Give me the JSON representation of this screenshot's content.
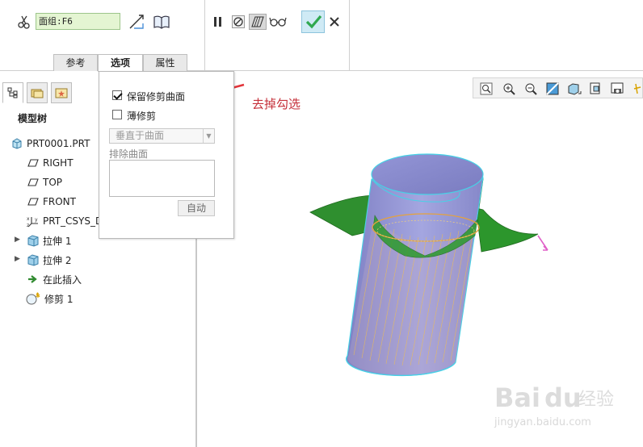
{
  "dashboard": {
    "reference_value": "面组:F6",
    "tabs": [
      {
        "label": "参考",
        "active": false
      },
      {
        "label": "选项",
        "active": true
      },
      {
        "label": "属性",
        "active": false
      }
    ]
  },
  "left_panel": {
    "title": "模型树",
    "items": [
      {
        "label": "PRT0001.PRT",
        "icon": "part-icon"
      },
      {
        "label": "RIGHT",
        "icon": "datum-plane-icon"
      },
      {
        "label": "TOP",
        "icon": "datum-plane-icon"
      },
      {
        "label": "FRONT",
        "icon": "datum-plane-icon"
      },
      {
        "label": "PRT_CSYS_D",
        "icon": "csys-icon"
      },
      {
        "label": "拉伸 1",
        "icon": "extrude-icon",
        "expandable": true
      },
      {
        "label": "拉伸 2",
        "icon": "extrude-icon",
        "expandable": true
      },
      {
        "label": "在此插入",
        "icon": "insert-here-icon"
      },
      {
        "label": "修剪 1",
        "icon": "trim-icon"
      }
    ]
  },
  "options_panel": {
    "keep_trimmed_surface": {
      "label": "保留修剪曲面",
      "checked": true
    },
    "thin_trim": {
      "label": "薄修剪",
      "checked": false
    },
    "direction_select": "垂直于曲面",
    "exclude_label": "排除曲面",
    "auto_button": "自动"
  },
  "annotation": {
    "text": "去掉勾选",
    "color": "#c5303a"
  },
  "colors": {
    "cylinder": "#8e8ed0",
    "surface": "#2f9a2f",
    "cylinder_edge": "#46d2e6",
    "trim_curve": "#e6a23c",
    "ok_button": "#cfeaf5"
  },
  "watermark": {
    "text": "jingyan.baidu.com"
  }
}
